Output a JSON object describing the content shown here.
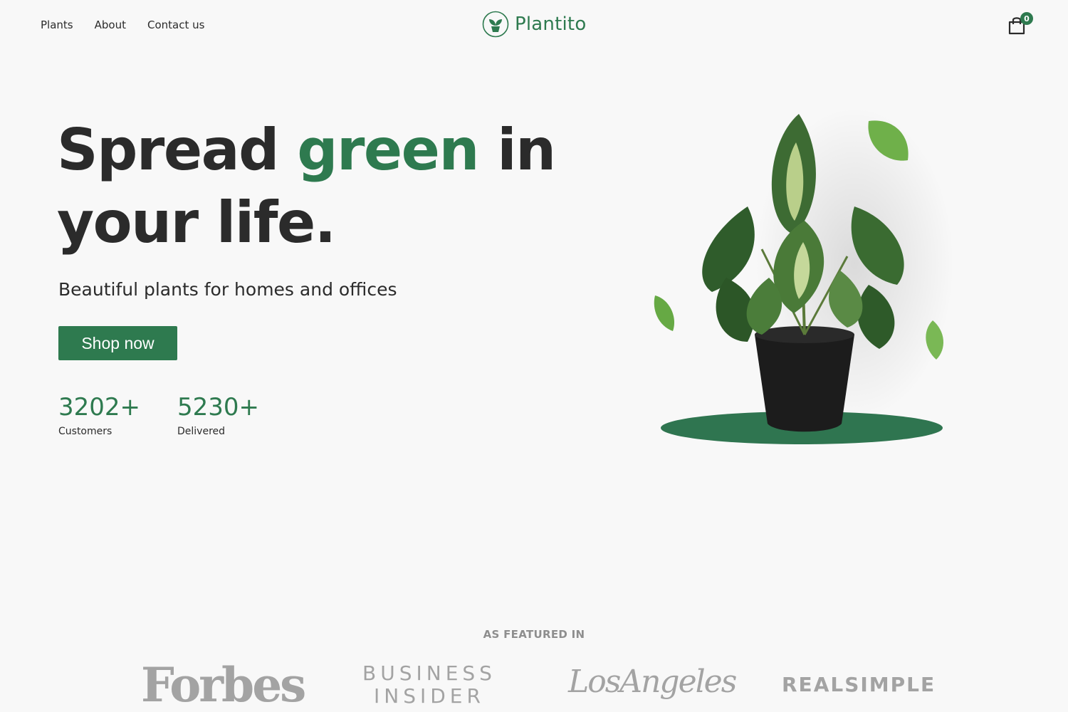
{
  "nav": {
    "links": [
      "Plants",
      "About",
      "Contact us"
    ],
    "brand": "Plantito",
    "cart_count": "0"
  },
  "hero": {
    "title_part1": "Spread ",
    "title_accent": "green",
    "title_part2": " in your life.",
    "subtitle": "Beautiful plants for homes and offices",
    "cta_label": "Shop now",
    "stats": [
      {
        "value": "3202+",
        "label": "Customers"
      },
      {
        "value": "5230+",
        "label": "Delivered"
      }
    ]
  },
  "featured": {
    "heading": "AS FEATURED IN",
    "logos": [
      "Forbes",
      "BUSINESS INSIDER",
      "LosAngeles",
      "REALSIMPLE"
    ]
  },
  "colors": {
    "brand_green": "#2e7a4f",
    "text_dark": "#2b2b2b",
    "background": "#f8f8f8",
    "logo_gray": "#a3a3a3"
  }
}
